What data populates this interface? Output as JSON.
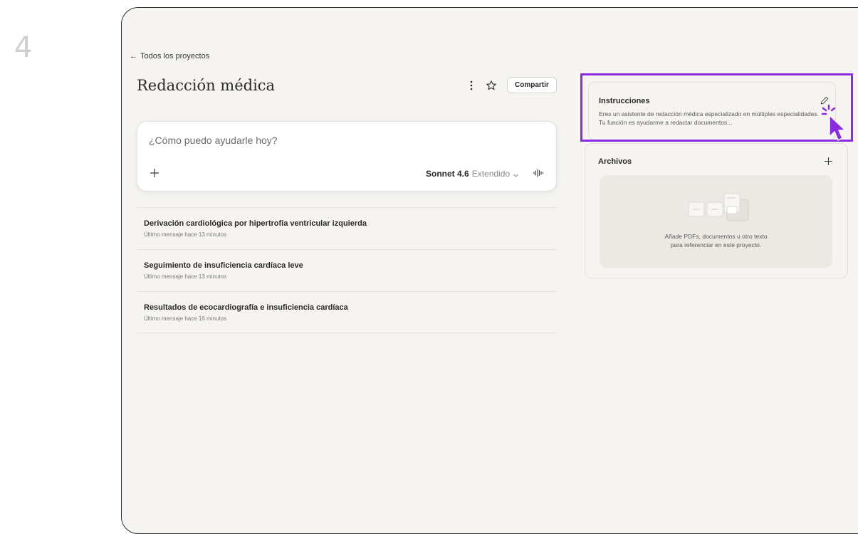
{
  "step_number": "4",
  "nav": {
    "back_label": "Todos los proyectos"
  },
  "project": {
    "title": "Redacción médica",
    "share_label": "Compartir"
  },
  "chat": {
    "placeholder": "¿Cómo puedo ayudarle hoy?",
    "model_name": "Sonnet 4.6",
    "model_mode": "Extendido"
  },
  "conversations": [
    {
      "title": "Derivación cardiológica por hipertrofia ventricular izquierda",
      "meta": "Último mensaje hace 13 minutos"
    },
    {
      "title": "Seguimiento de insuficiencia cardíaca leve",
      "meta": "Último mensaje hace 13 minutos"
    },
    {
      "title": "Resultados de ecocardiografía e insuficiencia cardíaca",
      "meta": "Último mensaje hace 16 minutos"
    }
  ],
  "instructions": {
    "title": "Instrucciones",
    "text": "Eres un asistente de redacción médica especializado en múltiples especialidades. Tu función es ayudarme a redactar documentos..."
  },
  "files": {
    "title": "Archivos",
    "empty_line1": "Añade PDFs, documentos u otro texto",
    "empty_line2": "para referenciar en este proyecto."
  },
  "icons": [
    "back-arrow-icon",
    "kebab-menu-icon",
    "star-icon",
    "plus-icon",
    "chevron-down-icon",
    "voice-waveform-icon",
    "pencil-icon",
    "document-stack-icon",
    "cursor-click-icon"
  ],
  "colors": {
    "highlight": "#8a2be2",
    "background": "#f5f4f1",
    "text": "#2b2a27"
  }
}
